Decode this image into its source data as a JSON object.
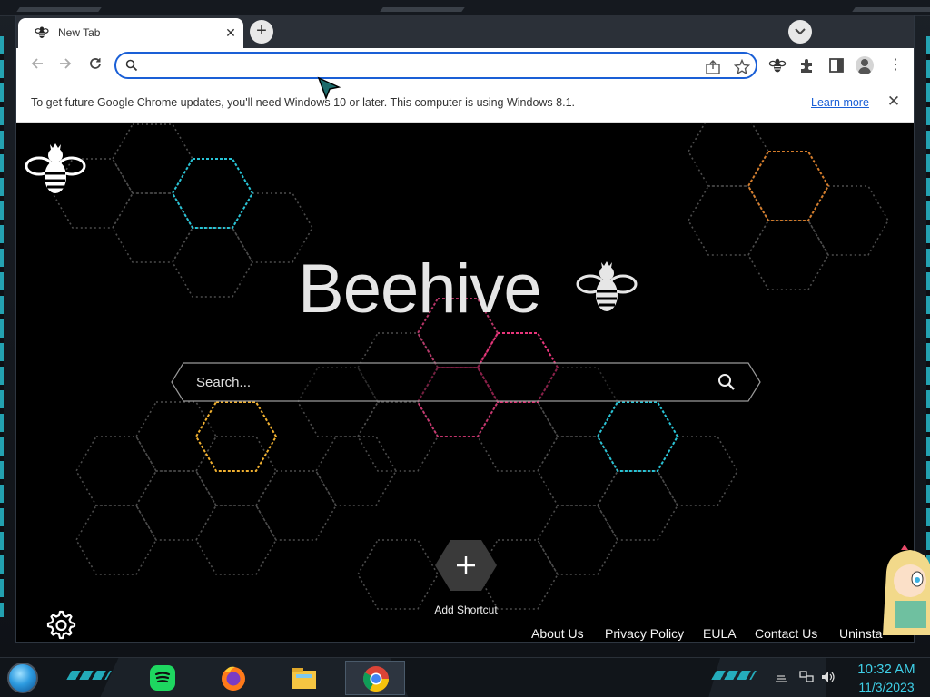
{
  "browser": {
    "tab": {
      "title": "New Tab",
      "close_glyph": "✕"
    },
    "new_tab_glyph": "+",
    "omnibox": {
      "value": "",
      "placeholder": ""
    },
    "infobar": {
      "message": "To get future Google Chrome updates, you'll need Windows 10 or later. This computer is using Windows 8.1.",
      "link": "Learn more",
      "close_glyph": "✕"
    },
    "menu_glyph": "⋮"
  },
  "page": {
    "brand": "Beehive",
    "search_placeholder": "Search...",
    "shortcut_label": "Add Shortcut",
    "footer_links": [
      "About Us",
      "Privacy Policy",
      "EULA",
      "Contact Us",
      "Uninsta"
    ]
  },
  "taskbar": {
    "time": "10:32 AM",
    "date": "11/3/2023",
    "apps": [
      "spotify-icon",
      "firefox-icon",
      "file-explorer-icon",
      "chrome-icon"
    ]
  },
  "colors": {
    "accent_blue": "#1a5fd6",
    "cyan": "#27c4d6",
    "pink": "#e8357a",
    "orange": "#f08a2a"
  }
}
